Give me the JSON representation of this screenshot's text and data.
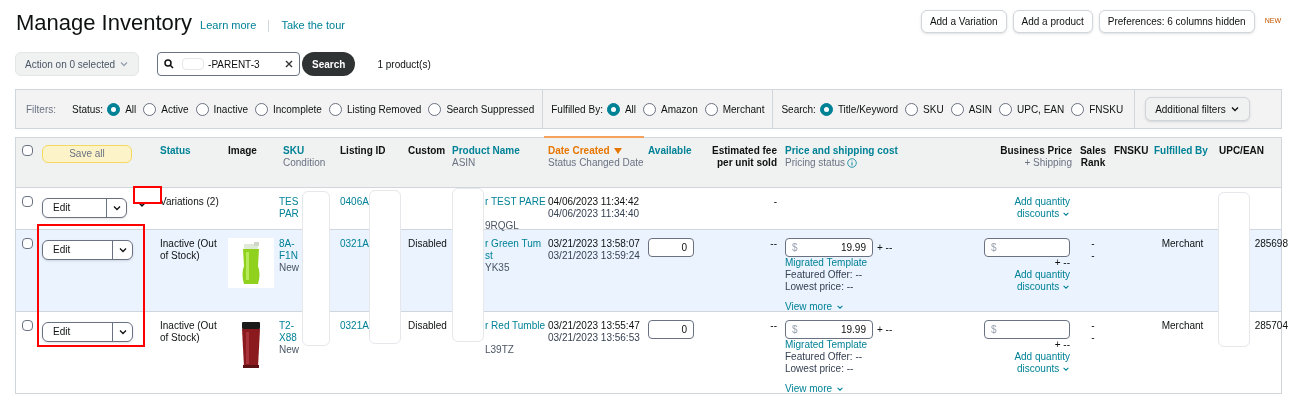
{
  "header": {
    "title": "Manage Inventory",
    "links": [
      "Learn more",
      "Take the tour"
    ],
    "buttons": [
      "Add a Variation",
      "Add a product",
      "Preferences: 6 columns hidden"
    ],
    "badge": "NEW"
  },
  "toolbar": {
    "action": "Action on 0 selected",
    "search_value": "-PARENT-3",
    "search_button": "Search",
    "count": "1 product(s)"
  },
  "filters": {
    "label": "Filters:",
    "groups": [
      {
        "label": "Status:",
        "options": [
          {
            "label": "All",
            "selected": true
          },
          {
            "label": "Active",
            "selected": false
          },
          {
            "label": "Inactive",
            "selected": false
          },
          {
            "label": "Incomplete",
            "selected": false
          },
          {
            "label": "Listing Removed",
            "selected": false
          },
          {
            "label": "Search Suppressed",
            "selected": false
          }
        ]
      },
      {
        "label": "Fulfilled By:",
        "options": [
          {
            "label": "All",
            "selected": true
          },
          {
            "label": "Amazon",
            "selected": false
          },
          {
            "label": "Merchant",
            "selected": false
          }
        ]
      },
      {
        "label": "Search:",
        "options": [
          {
            "label": "Title/Keyword",
            "selected": true
          },
          {
            "label": "SKU",
            "selected": false
          },
          {
            "label": "ASIN",
            "selected": false
          },
          {
            "label": "UPC, EAN",
            "selected": false
          },
          {
            "label": "FNSKU",
            "selected": false
          }
        ]
      }
    ],
    "more": "Additional filters"
  },
  "table": {
    "select_all_checked": false,
    "save_all": "Save all",
    "columns": [
      {
        "title": "Status",
        "kind": "link"
      },
      {
        "title": "Image",
        "kind": "plain"
      },
      {
        "title": "SKU",
        "sub": "Condition",
        "kind": "link"
      },
      {
        "title": "Listing ID",
        "kind": "plain"
      },
      {
        "title": "Custom",
        "kind": "plain"
      },
      {
        "title": "Product Name",
        "sub": "ASIN",
        "kind": "link"
      },
      {
        "title": "Date Created",
        "sub": "Status Changed Date",
        "kind": "sorted"
      },
      {
        "title": "Available",
        "kind": "link"
      },
      {
        "title": "Estimated fee per unit sold",
        "kind": "plain"
      },
      {
        "title": "Price and shipping cost",
        "sub": "Pricing status",
        "kind": "info"
      },
      {
        "title": "Business Price",
        "sub": "+ Shipping",
        "kind": "plain"
      },
      {
        "title": "Sales Rank",
        "kind": "plain"
      },
      {
        "title": "FNSKU",
        "kind": "plain"
      },
      {
        "title": "Fulfilled By",
        "kind": "link"
      },
      {
        "title": "UPC/EAN",
        "kind": "plain"
      }
    ],
    "rows": [
      {
        "kind": "parent",
        "checked": false,
        "highlighted": false,
        "edit": "Edit",
        "status": "Variations (2)",
        "sku": [
          "TES",
          "PAR"
        ],
        "listing_id": "0406A",
        "product_name": [
          "r TEST PARE"
        ],
        "asin": "9RQGL",
        "created": "04/06/2023 11:34:42",
        "changed": "04/06/2023 11:34:40",
        "fee": "-",
        "business_link": "Add quantity discounts"
      },
      {
        "kind": "child",
        "checked": false,
        "highlighted": true,
        "edit": "Edit",
        "status": "Inactive (Out of Stock)",
        "image": {
          "kind": "picture"
        },
        "sku": [
          "8A-",
          "F1N",
          "New"
        ],
        "listing_id": "0321A",
        "custom": "Disabled",
        "product_name": [
          "r Green Tum",
          "st"
        ],
        "asin": "YK35",
        "created": "03/21/2023 13:58:07",
        "changed": "03/21/2023 13:59:24",
        "available": "0",
        "fee": "--",
        "price": {
          "currency": "$",
          "value": "19.99",
          "shipping": "+ --",
          "status": "Migrated Template",
          "featured": "Featured Offer: --",
          "lowest": "Lowest price: --",
          "more": "View more"
        },
        "business": {
          "currency": "$",
          "shipping": "+ --"
        },
        "business_link": "Add quantity discounts",
        "sales_rank": [
          "-",
          "-"
        ],
        "fulfilled_by": "Merchant",
        "upc": "285698"
      },
      {
        "kind": "child",
        "checked": false,
        "highlighted": false,
        "edit": "Edit",
        "status": "Inactive (Out of Stock)",
        "image": {
          "kind": "picture"
        },
        "sku": [
          "T2-",
          "X88",
          "New"
        ],
        "listing_id": "0321A",
        "custom": "Disabled",
        "product_name": [
          "r Red Tumble"
        ],
        "asin": "L39TZ",
        "created": "03/21/2023 13:55:47",
        "changed": "03/21/2023 13:56:53",
        "available": "0",
        "fee": "--",
        "price": {
          "currency": "$",
          "value": "19.99",
          "shipping": "+ --",
          "status": "Migrated Template",
          "featured": "Featured Offer: --",
          "lowest": "Lowest price: --",
          "more": "View more"
        },
        "business": {
          "currency": "$",
          "shipping": "+ --"
        },
        "business_link": "Add quantity discounts",
        "sales_rank": [
          "-",
          "-"
        ],
        "fulfilled_by": "Merchant",
        "upc": "285704"
      }
    ]
  }
}
